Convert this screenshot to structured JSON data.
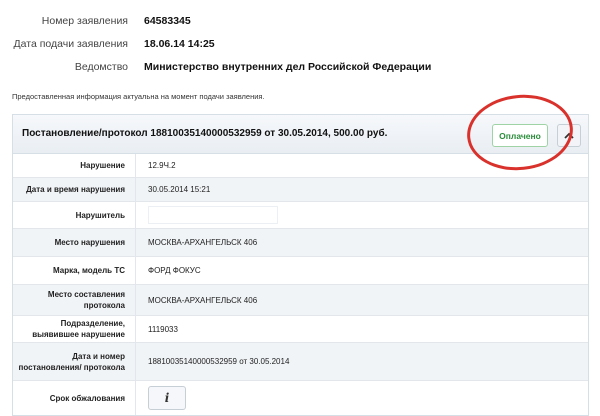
{
  "application": {
    "number_label": "Номер заявления",
    "number_value": "64583345",
    "date_label": "Дата подачи заявления",
    "date_value": "18.06.14 14:25",
    "agency_label": "Ведомство",
    "agency_value": "Министерство внутренних дел Российской Федерации"
  },
  "note": "Предоставленная информация актуальна на момент подачи заявления.",
  "ruling": {
    "title": "Постановление/протокол 18810035140000532959 от 30.05.2014, 500.00 руб.",
    "status": "Оплачено",
    "status_color": "#2a8c3a",
    "highlight_color": "#d9312b",
    "collapse_icon": "chevron-up-icon"
  },
  "details": [
    {
      "label": "Нарушение",
      "value": "12.9Ч.2"
    },
    {
      "label": "Дата и время нарушения",
      "value": "30.05.2014 15:21"
    },
    {
      "label": "Нарушитель",
      "value": ""
    },
    {
      "label": "Место нарушения",
      "value": "МОСКВА-АРХАНГЕЛЬСК 406"
    },
    {
      "label": "Марка, модель ТС",
      "value": "ФОРД ФОКУС"
    },
    {
      "label": "Место составления протокола",
      "value": "МОСКВА-АРХАНГЕЛЬСК 406"
    },
    {
      "label": "Подразделение, выявившее нарушение",
      "value": "1119033"
    },
    {
      "label": "Дата и номер постановления/ протокола",
      "value": "18810035140000532959 от 30.05.2014"
    },
    {
      "label": "Срок обжалования",
      "value": "i",
      "icon": "info-icon"
    }
  ]
}
